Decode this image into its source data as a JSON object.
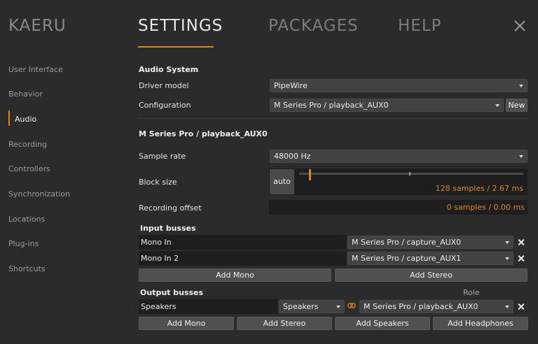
{
  "brand": "KAERU",
  "tabs": [
    {
      "label": "SETTINGS",
      "active": true
    },
    {
      "label": "PACKAGES",
      "active": false
    },
    {
      "label": "HELP",
      "active": false
    }
  ],
  "sidebar": {
    "items": [
      {
        "label": "User Interface"
      },
      {
        "label": "Behavior"
      },
      {
        "label": "Audio",
        "active": true
      },
      {
        "label": "Recording"
      },
      {
        "label": "Controllers"
      },
      {
        "label": "Synchronization"
      },
      {
        "label": "Locations"
      },
      {
        "label": "Plug-ins"
      },
      {
        "label": "Shortcuts"
      }
    ]
  },
  "audio_system": {
    "heading": "Audio System",
    "driver_label": "Driver model",
    "driver_value": "PipeWire",
    "config_label": "Configuration",
    "config_value": "M Series Pro / playback_AUX0",
    "new_label": "New"
  },
  "device": {
    "heading": "M Series Pro / playback_AUX0",
    "sample_rate_label": "Sample rate",
    "sample_rate_value": "48000 Hz",
    "block_size_label": "Block size",
    "auto_label": "auto",
    "block_size_value": "128 samples / 2.67 ms",
    "recording_offset_label": "Recording offset",
    "recording_offset_value": "0 samples / 0.00 ms"
  },
  "input_busses": {
    "heading": "Input busses",
    "rows": [
      {
        "name": "Mono In",
        "port": "M Series Pro / capture_AUX0"
      },
      {
        "name": "Mono In 2",
        "port": "M Series Pro / capture_AUX1"
      }
    ],
    "add_mono": "Add Mono",
    "add_stereo": "Add Stereo"
  },
  "output_busses": {
    "heading": "Output busses",
    "role_label": "Role",
    "rows": [
      {
        "name": "Speakers",
        "role": "Speakers",
        "port": "M Series Pro / playback_AUX0"
      }
    ],
    "add_mono": "Add Mono",
    "add_stereo": "Add Stereo",
    "add_speakers": "Add Speakers",
    "add_headphones": "Add Headphones"
  },
  "colors": {
    "accent": "#e0861b",
    "background": "#2b2b2b",
    "field": "#1e1e1e"
  }
}
